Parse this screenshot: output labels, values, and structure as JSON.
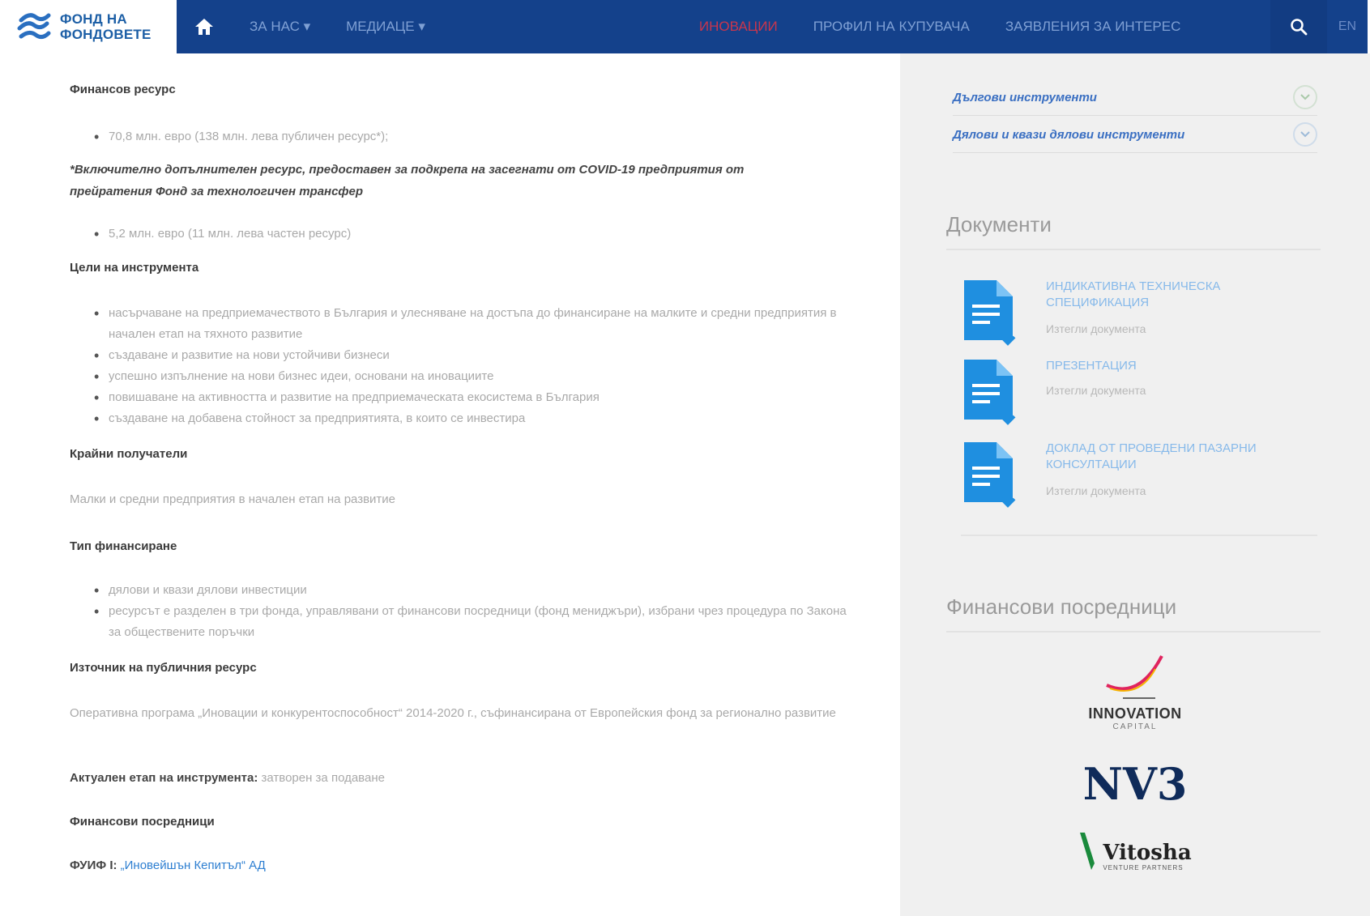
{
  "header": {
    "logo_line1": "ФОНД НА",
    "logo_line2": "ФОНДОВЕТЕ",
    "nav": [
      {
        "label": "ЗА НАС ▾"
      },
      {
        "label": "МЕДИАЦЕ ▾"
      },
      {
        "label": "ИНОВАЦИИ"
      },
      {
        "label": "ПРОФИЛ НА КУПУВАЧА"
      },
      {
        "label": "ЗАЯВЛЕНИЯ ЗА ИНТЕРЕС"
      }
    ],
    "lang": "EN"
  },
  "main": {
    "h_resource": "Финансов ресурс",
    "resource_bullet1": "70,8 млн. евро (138 млн. лева публичен ресурс*);",
    "note": "*Включително допълнителен ресурс, предоставен за подкрепа на засегнати от COVID-19 предприятия от прейратения Фонд за технологичен трансфер",
    "resource_bullet2": "5,2 млн. евро (11 млн. лева частен ресурс)",
    "h_goals": "Цели на инструмента",
    "goals": [
      "насърчаване на предприемачеството в България и улесняване на достъпа до финансиране на малките и средни предприятия в начален етап на тяхното развитие",
      "създаване и развитие на нови устойчиви бизнеси",
      "успешно изпълнение на нови бизнес идеи, основани на иновациите",
      "повишаване на активността и развитие на предприемаческата екосистема в България",
      "създаване на добавена стойност за предприятията, в които се инвестира"
    ],
    "h_recipients": "Крайни получатели",
    "recipients_text": "Малки и средни предприятия в начален етап на развитие",
    "h_type": "Тип финансиране",
    "type_items": [
      "дялови и квази дялови инвестиции",
      "ресурсът е разделен в три фонда, управлявани от финансови посредници (фонд мениджъри), избрани чрез процедура по Закона за обществените поръчки"
    ],
    "h_source": "Източник на публичния ресурс",
    "source_text": "Оперативна програма „Иновации и конкурентоспособност“ 2014-2020 г., съфинансирана от Европейския фонд за регионално развитие",
    "stage_label": "Актуален етап на инструмента:",
    "stage_value": "затворен за подаване",
    "h_intermediaries": "Финансови посредници",
    "fund_prefix": "ФУИФ I:",
    "fund_link": "„Иновейшън Кепитъл“ АД"
  },
  "sidebar": {
    "accordion": [
      {
        "label": "Дългови инструменти"
      },
      {
        "label": "Дялови и квази дялови инструменти"
      }
    ],
    "documents_title": "Документи",
    "documents": [
      {
        "title": "ИНДИКАТИВНА ТЕХНИЧЕСКА СПЕЦИФИКАЦИЯ",
        "subtitle": "Изтегли документа"
      },
      {
        "title": "ПРЕЗЕНТАЦИЯ",
        "subtitle": "Изтегли документа"
      },
      {
        "title": "ДОКЛАД ОТ ПРОВЕДЕНИ ПАЗАРНИ КОНСУЛТАЦИИ",
        "subtitle": "Изтегли документа"
      }
    ],
    "intermediaries_title": "Финансови посредници",
    "logos": [
      {
        "name": "INNOVATION",
        "sub": "CAPITAL"
      },
      {
        "name": "NV3"
      },
      {
        "name": "Vitosha",
        "sub": "VENTURE PARTNERS"
      }
    ]
  },
  "colors": {
    "nav_bg": "#14418b",
    "accent_blue": "#2e7fd1",
    "doc_icon": "#1f8fe0",
    "active_nav": "#c9364d"
  }
}
